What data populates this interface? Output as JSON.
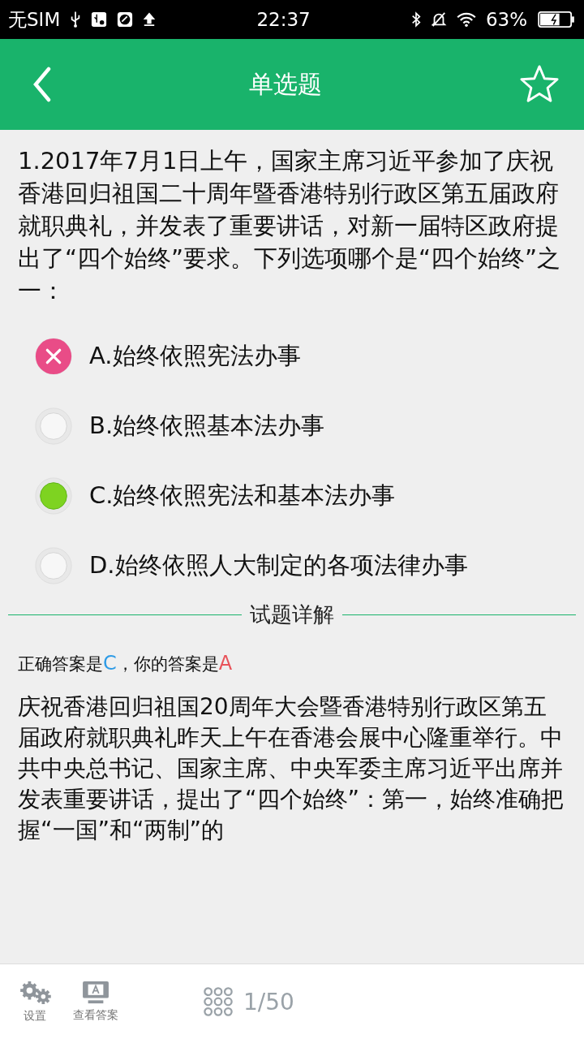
{
  "status_bar": {
    "carrier": "无SIM",
    "time": "22:37",
    "battery": "63%"
  },
  "header": {
    "title": "单选题",
    "favorited": false
  },
  "question": {
    "text": "1.2017年7月1日上午，国家主席习近平参加了庆祝香港回归祖国二十周年暨香港特别行政区第五届政府就职典礼，并发表了重要讲话，对新一届特区政府提出了“四个始终”要求。下列选项哪个是“四个始终”之一：",
    "options": [
      {
        "text": "A.始终依照宪法办事",
        "selected": true,
        "correct": false
      },
      {
        "text": "B.始终依照基本法办事",
        "selected": false,
        "correct": false
      },
      {
        "text": "C.始终依照宪法和基本法办事",
        "selected": false,
        "correct": true
      },
      {
        "text": "D.始终依照人大制定的各项法律办事",
        "selected": false,
        "correct": false
      }
    ]
  },
  "detail": {
    "heading": "试题详解",
    "answer_prefix": "正确答案是",
    "correct_answer": "C",
    "answer_middle": "，你的答案是",
    "your_answer": "A",
    "explanation": "庆祝香港回归祖国20周年大会暨香港特别行政区第五届政府就职典礼昨天上午在香港会展中心隆重举行。中共中央总书记、国家主席、中央军委主席习近平出席并发表重要讲话，提出了“四个始终”：第一，始终准确把握“一国”和“两制”的"
  },
  "bottom_bar": {
    "settings": "设置",
    "view_answer": "查看答案",
    "progress": "1/50"
  }
}
